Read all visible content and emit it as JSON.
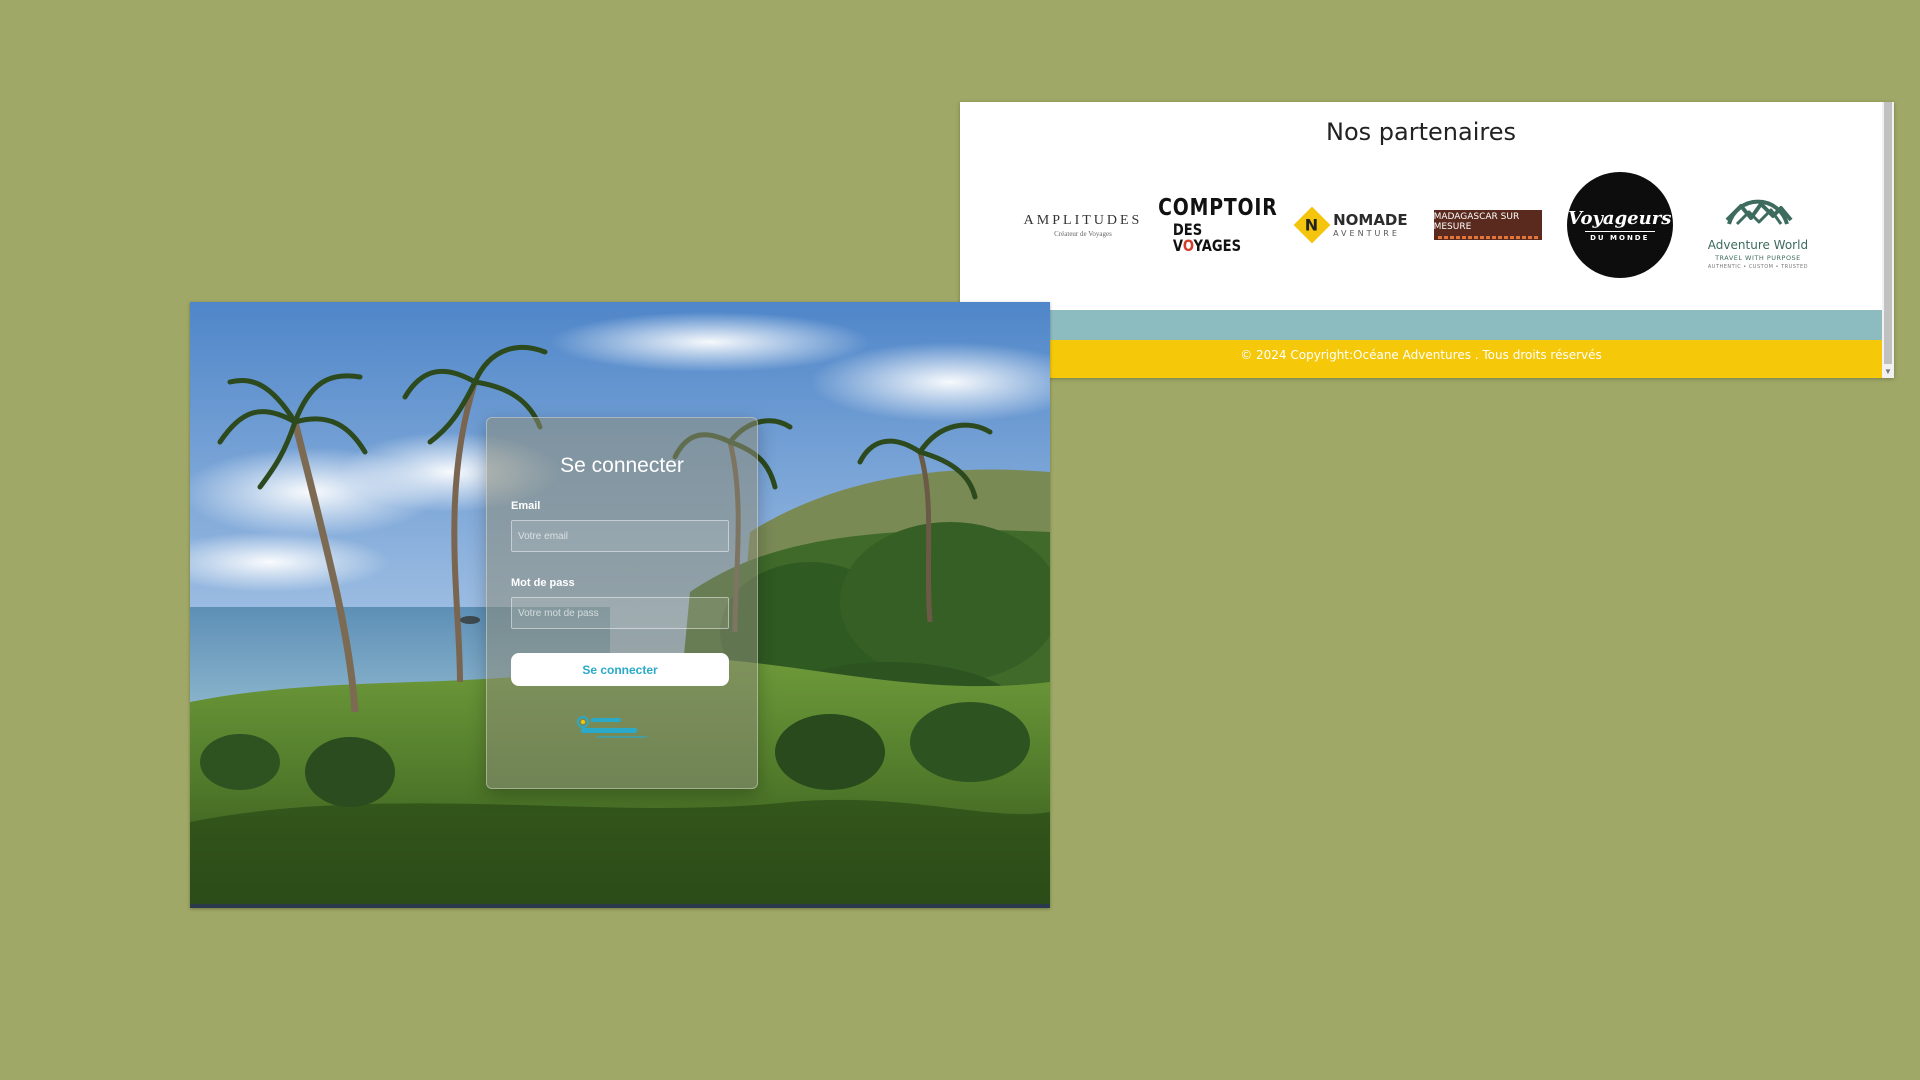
{
  "partners": {
    "title": "Nos partenaires",
    "logos": [
      {
        "name": "AMPLITUDES",
        "tagline": "Créateur de Voyages"
      },
      {
        "line1": "COMPTOIR",
        "line2_pre": "DES V",
        "line2_o": "O",
        "line2_post": "YAGES"
      },
      {
        "mark": "N",
        "name": "NOMADE",
        "tagline": "AVENTURE"
      },
      {
        "name": "MADAGASCAR SUR MESURE"
      },
      {
        "name": "Voyageurs",
        "tagline": "DU MONDE"
      },
      {
        "name": "Adventure World",
        "tagline": "TRAVEL WITH PURPOSE",
        "subline": "AUTHENTIC • CUSTOM • TRUSTED"
      }
    ],
    "footer": "© 2024 Copyright:Océane Adventures . Tous droits réservés"
  },
  "login": {
    "title": "Se connecter",
    "email_label": "Email",
    "email_placeholder": "Votre email",
    "password_label": "Mot de pass",
    "password_placeholder": "Votre mot de pass",
    "submit_label": "Se connecter"
  },
  "colors": {
    "desktop_background": "#9fa866",
    "footer_teal": "#8cbcc0",
    "footer_yellow": "#f5c80a",
    "button_text": "#2aa9c9"
  }
}
